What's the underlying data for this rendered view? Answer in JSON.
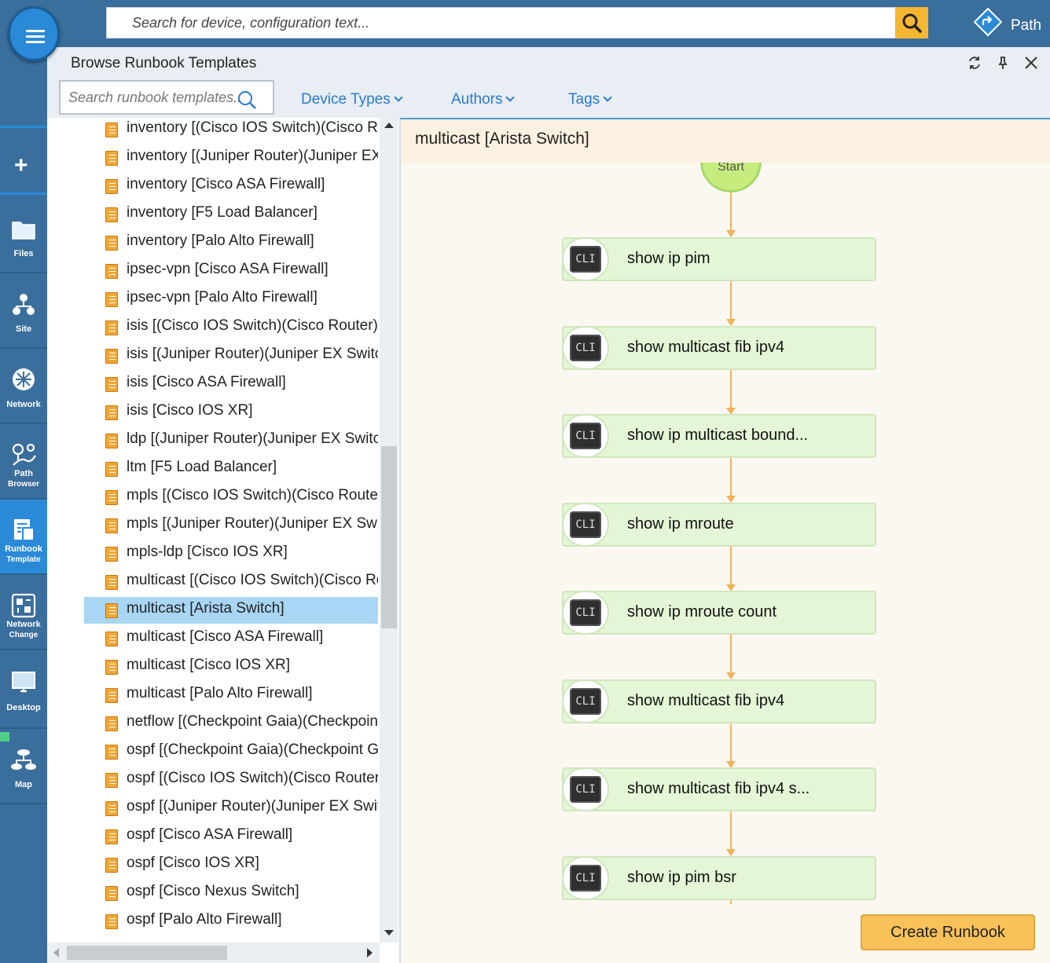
{
  "app": {
    "search_placeholder": "Search for device, configuration text...",
    "path_label": "Path"
  },
  "sidebar": {
    "items": [
      {
        "label": "Files",
        "icon": "folder-icon"
      },
      {
        "label": "Site",
        "icon": "site-icon"
      },
      {
        "label": "Network",
        "icon": "network-icon"
      },
      {
        "label": "Path Browser",
        "icon": "path-browser-icon"
      },
      {
        "label": "Runbook Template",
        "icon": "runbook-template-icon",
        "active": true
      },
      {
        "label": "Network Change",
        "icon": "network-change-icon"
      },
      {
        "label": "Desktop",
        "icon": "desktop-icon"
      },
      {
        "label": "Map",
        "icon": "map-icon"
      }
    ]
  },
  "panel": {
    "title": "Browse Runbook Templates",
    "search_placeholder": "Search runbook templates...",
    "filters": [
      "Device Types",
      "Authors",
      "Tags"
    ]
  },
  "templates": [
    "inventory [(Cisco IOS Switch)(Cisco Router)]",
    "inventory [(Juniper Router)(Juniper EX Switch)]",
    "inventory [Cisco ASA Firewall]",
    "inventory [F5 Load Balancer]",
    "inventory [Palo Alto Firewall]",
    "ipsec-vpn [Cisco ASA Firewall]",
    "ipsec-vpn [Palo Alto Firewall]",
    "isis [(Cisco IOS Switch)(Cisco Router)]",
    "isis [(Juniper Router)(Juniper EX Switch)]",
    "isis [Cisco ASA Firewall]",
    "isis [Cisco IOS XR]",
    "ldp [(Juniper Router)(Juniper EX Switch)]",
    "ltm [F5 Load Balancer]",
    "mpls [(Cisco IOS Switch)(Cisco Router)]",
    "mpls [(Juniper Router)(Juniper EX Switch)]",
    "mpls-ldp [Cisco IOS XR]",
    "multicast [(Cisco IOS Switch)(Cisco Router)]",
    "multicast [Arista Switch]",
    "multicast [Cisco ASA Firewall]",
    "multicast [Cisco IOS XR]",
    "multicast [Palo Alto Firewall]",
    "netflow [(Checkpoint Gaia)(Checkpoint Gaia)]",
    "ospf [(Checkpoint Gaia)(Checkpoint Gaia)]",
    "ospf [(Cisco IOS Switch)(Cisco Router)]",
    "ospf [(Juniper Router)(Juniper EX Switch)]",
    "ospf [Cisco ASA Firewall]",
    "ospf [Cisco IOS XR]",
    "ospf [Cisco Nexus Switch]",
    "ospf [Palo Alto Firewall]"
  ],
  "selected_template_index": 17,
  "detail": {
    "title": "multicast [Arista Switch]",
    "start_label": "Start",
    "badge": "CLI",
    "nodes": [
      "show ip pim",
      "show multicast fib ipv4",
      "show ip multicast bound...",
      "show ip mroute",
      "show ip mroute count",
      "show multicast fib ipv4",
      "show multicast fib ipv4 s...",
      "show ip pim bsr"
    ],
    "create_button": "Create Runbook"
  },
  "colors": {
    "sidebar": "#3a6e9c",
    "accent": "#2a8ad8",
    "search_button": "#f5b731",
    "node_fill": "#e4f6d6",
    "connector": "#f0b25a",
    "create_button": "#f9c15a",
    "selected_row": "#a8d6f4"
  }
}
